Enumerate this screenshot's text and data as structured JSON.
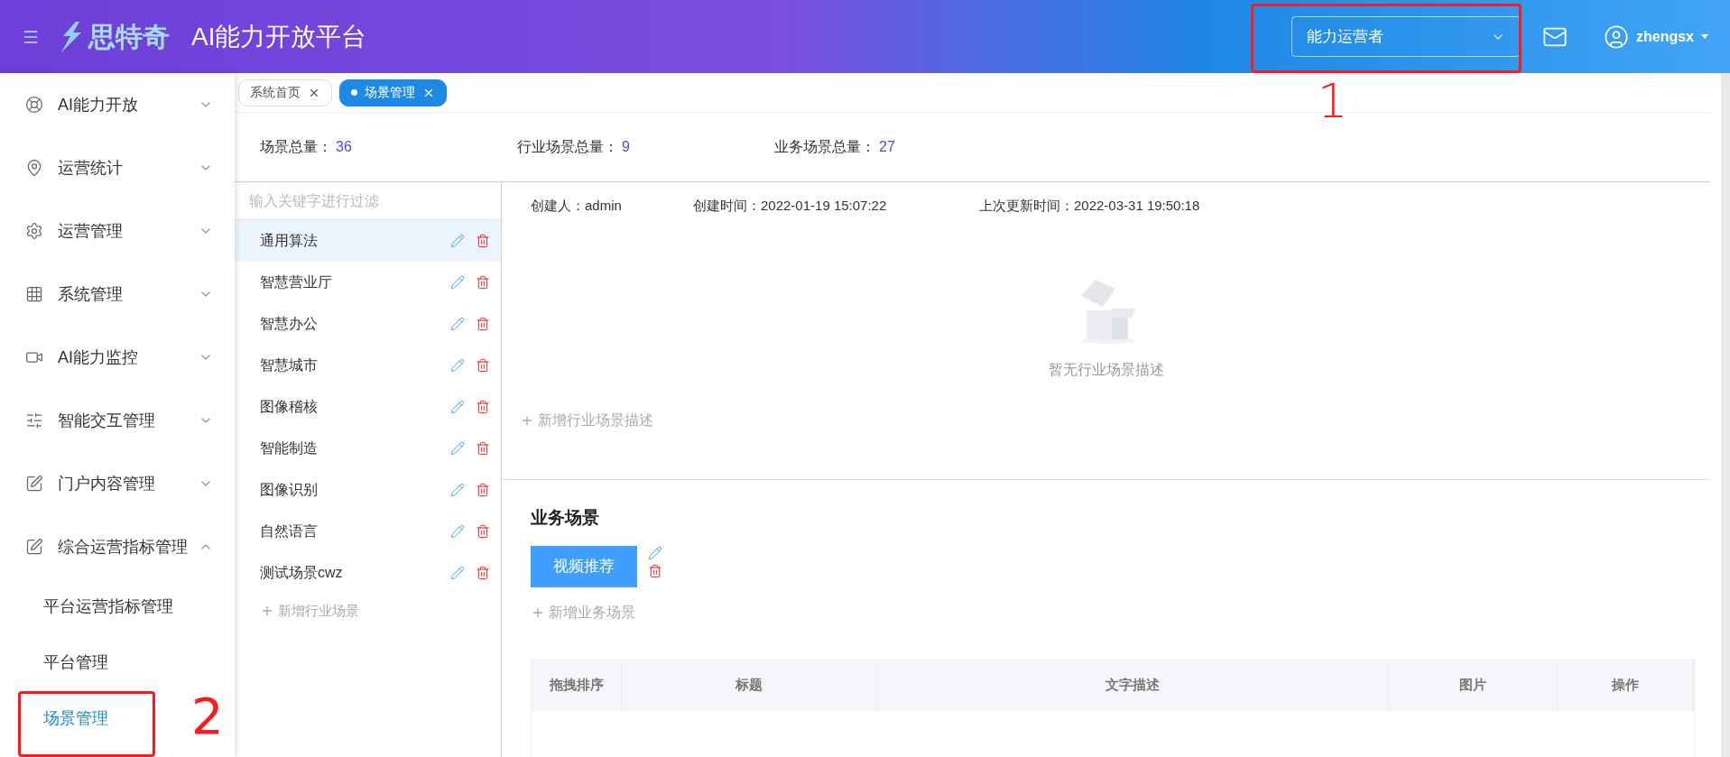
{
  "header": {
    "logo": "思特奇",
    "title": "AI能力开放平台",
    "role_select": {
      "value": "能力运营者"
    },
    "user": "zhengsx"
  },
  "sidebar": {
    "items": [
      {
        "label": "AI能力开放",
        "expanded": false
      },
      {
        "label": "运营统计",
        "expanded": false
      },
      {
        "label": "运营管理",
        "expanded": false
      },
      {
        "label": "系统管理",
        "expanded": false
      },
      {
        "label": "AI能力监控",
        "expanded": false
      },
      {
        "label": "智能交互管理",
        "expanded": false
      },
      {
        "label": "门户内容管理",
        "expanded": false
      },
      {
        "label": "综合运营指标管理",
        "expanded": true,
        "children": [
          {
            "label": "平台运营指标管理",
            "selected": false
          },
          {
            "label": "平台管理",
            "selected": false
          },
          {
            "label": "场景管理",
            "selected": true
          }
        ]
      }
    ]
  },
  "tabs": [
    {
      "label": "系统首页",
      "selected": false
    },
    {
      "label": "场景管理",
      "selected": true
    }
  ],
  "stats": [
    {
      "label": "场景总量：",
      "value": "36"
    },
    {
      "label": "行业场景总量：",
      "value": "9"
    },
    {
      "label": "业务场景总量：",
      "value": "27"
    }
  ],
  "scene_list": {
    "placeholder": "输入关键字进行过滤",
    "items": [
      {
        "label": "通用算法",
        "selected": true
      },
      {
        "label": "智慧营业厅",
        "selected": false
      },
      {
        "label": "智慧办公",
        "selected": false
      },
      {
        "label": "智慧城市",
        "selected": false
      },
      {
        "label": "图像稽核",
        "selected": false
      },
      {
        "label": "智能制造",
        "selected": false
      },
      {
        "label": "图像识别",
        "selected": false
      },
      {
        "label": "自然语言",
        "selected": false
      },
      {
        "label": "测试场景cwz",
        "selected": false
      }
    ],
    "add_label": "新增行业场景"
  },
  "detail": {
    "meta": [
      "创建人：admin",
      "创建时间：2022-01-19 15:07:22",
      "上次更新时间：2022-03-31 19:50:18"
    ],
    "empty_text": "暂无行业场景描述",
    "add_description": "新增行业场景描述",
    "business_title": "业务场景",
    "business_items": [
      "视频推荐"
    ],
    "add_business": "新增业务场景",
    "table_columns": [
      "拖拽排序",
      "标题",
      "文字描述",
      "图片",
      "操作"
    ]
  },
  "annotations": [
    "1",
    "2"
  ]
}
